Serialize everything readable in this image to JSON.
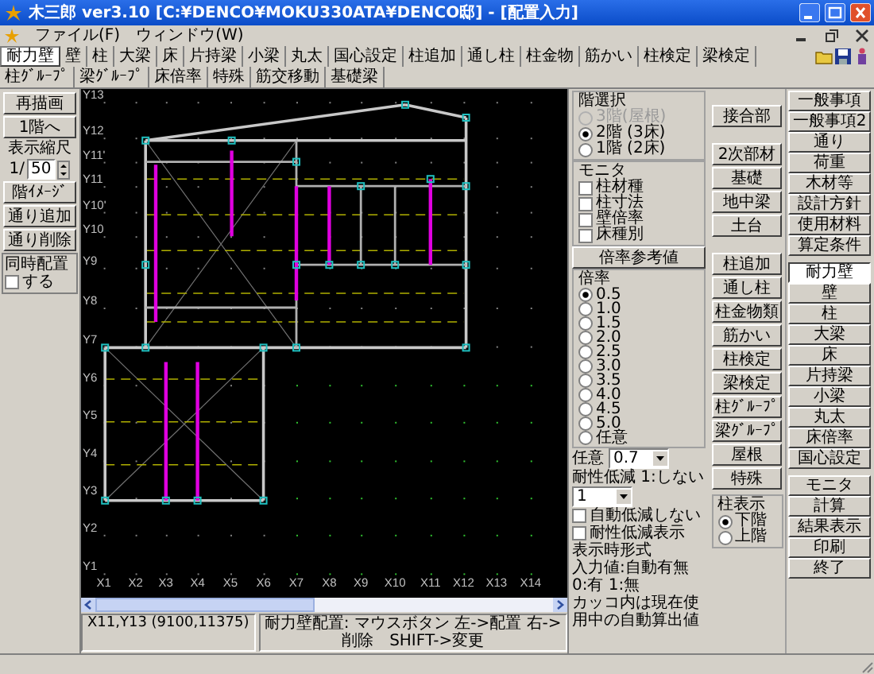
{
  "window": {
    "title": "木三郎 ver3.10 [C:¥DENCO¥MOKU330ATA¥DENCO邸] - [配置入力]"
  },
  "menu": [
    "ファイル(F)",
    "ウィンドウ(W)"
  ],
  "tabs": [
    {
      "label": "耐力壁",
      "selected": true
    },
    {
      "label": "壁",
      "selected": false
    },
    {
      "label": "柱",
      "selected": false
    },
    {
      "label": "大梁",
      "selected": false
    },
    {
      "label": "床",
      "selected": false
    },
    {
      "label": "片持梁",
      "selected": false
    },
    {
      "label": "小梁",
      "selected": false
    },
    {
      "label": "丸太",
      "selected": false
    },
    {
      "label": "国心設定",
      "selected": false
    },
    {
      "label": "柱追加",
      "selected": false
    },
    {
      "label": "通し柱",
      "selected": false
    },
    {
      "label": "柱金物",
      "selected": false
    },
    {
      "label": "筋かい",
      "selected": false
    },
    {
      "label": "柱検定",
      "selected": false
    },
    {
      "label": "梁検定",
      "selected": false
    },
    {
      "label": "柱ｸﾞﾙｰﾌﾟ",
      "selected": false
    },
    {
      "label": "梁ｸﾞﾙｰﾌﾟ",
      "selected": false
    },
    {
      "label": "床倍率",
      "selected": false
    },
    {
      "label": "特殊",
      "selected": false
    },
    {
      "label": "筋交移動",
      "selected": false
    },
    {
      "label": "基礎梁",
      "selected": false
    }
  ],
  "left_panel": {
    "top_buttons": [
      "再描画",
      "1階へ"
    ],
    "scale_label": "表示縮尺",
    "scale_prefix": "1/",
    "scale_value": "50",
    "buttons": [
      "階ｲﾒｰｼﾞ",
      "通り追加",
      "通り削除"
    ],
    "simultaneous": {
      "title": "同時配置",
      "label": "する",
      "checked": false
    }
  },
  "canvas": {
    "y_labels": [
      "Y13",
      "Y12",
      "Y11'",
      "Y11",
      "Y10'",
      "Y10",
      "Y9",
      "Y8",
      "Y7",
      "Y6",
      "Y5",
      "Y4",
      "Y3",
      "Y2",
      "Y1"
    ],
    "x_labels": [
      "X1",
      "X2",
      "X3",
      "X4",
      "X5",
      "X6",
      "X7",
      "X8",
      "X9",
      "X10",
      "X11",
      "X12",
      "X13",
      "X14"
    ]
  },
  "coordinates": "X11,Y13 (9100,11375)",
  "hint": "耐力壁配置: マウスボタン 左->配置 右->削除　SHIFT->変更",
  "right_panel": {
    "floor_select": {
      "title": "階選択",
      "options": [
        {
          "label": "3階(屋根)",
          "selected": false,
          "disabled": true
        },
        {
          "label": "2階 (3床)",
          "selected": true,
          "disabled": false
        },
        {
          "label": "1階 (2床)",
          "selected": false,
          "disabled": false
        }
      ]
    },
    "monitor": {
      "title": "モニタ",
      "items": [
        {
          "label": "柱材種",
          "checked": false
        },
        {
          "label": "柱寸法",
          "checked": false
        },
        {
          "label": "壁倍率",
          "checked": false
        },
        {
          "label": "床種別",
          "checked": false
        }
      ]
    },
    "reference_button": "倍率参考値",
    "ratio": {
      "title": "倍率",
      "options": [
        {
          "label": "0.5",
          "selected": true
        },
        {
          "label": "1.0",
          "selected": false
        },
        {
          "label": "1.5",
          "selected": false
        },
        {
          "label": "2.0",
          "selected": false
        },
        {
          "label": "2.5",
          "selected": false
        },
        {
          "label": "3.0",
          "selected": false
        },
        {
          "label": "3.5",
          "selected": false
        },
        {
          "label": "4.0",
          "selected": false
        },
        {
          "label": "4.5",
          "selected": false
        },
        {
          "label": "5.0",
          "selected": false
        },
        {
          "label": "任意",
          "selected": false
        }
      ]
    },
    "arbitrary": {
      "label": "任意",
      "value": "0.7"
    },
    "reduction": {
      "label": "耐性低減 1:しない",
      "value": "1"
    },
    "checks": [
      {
        "label": "自動低減しない",
        "checked": false
      },
      {
        "label": "耐性低減表示",
        "checked": false
      }
    ],
    "notes": [
      "表示時形式",
      "入力値:自動有無",
      "0:有 1:無",
      "カッコ内は現在使用中の自動算出値"
    ],
    "middle_buttons": [
      "接合部",
      "2次部材",
      "基礎",
      "地中梁",
      "土台",
      "柱追加",
      "通し柱",
      "柱金物類",
      "筋かい",
      "柱検定",
      "梁検定",
      "柱ｸﾞﾙｰﾌﾟ",
      "梁ｸﾞﾙｰﾌﾟ",
      "屋根",
      "特殊"
    ],
    "column_display": {
      "title": "柱表示",
      "options": [
        {
          "label": "下階",
          "selected": true
        },
        {
          "label": "上階",
          "selected": false
        }
      ]
    },
    "side_buttons": [
      {
        "label": "一般事項",
        "selected": false
      },
      {
        "label": "一般事項2",
        "selected": false
      },
      {
        "label": "通り",
        "selected": false
      },
      {
        "label": "荷重",
        "selected": false
      },
      {
        "label": "木材等",
        "selected": false
      },
      {
        "label": "設計方針",
        "selected": false
      },
      {
        "label": "使用材料",
        "selected": false
      },
      {
        "label": "算定条件",
        "selected": false
      },
      {
        "label": "耐力壁",
        "selected": true
      },
      {
        "label": "壁",
        "selected": false
      },
      {
        "label": "柱",
        "selected": false
      },
      {
        "label": "大梁",
        "selected": false
      },
      {
        "label": "床",
        "selected": false
      },
      {
        "label": "片持梁",
        "selected": false
      },
      {
        "label": "小梁",
        "selected": false
      },
      {
        "label": "丸太",
        "selected": false
      },
      {
        "label": "床倍率",
        "selected": false
      },
      {
        "label": "国心設定",
        "selected": false
      },
      {
        "label": "モニタ",
        "selected": false
      },
      {
        "label": "計算",
        "selected": false
      },
      {
        "label": "結果表示",
        "selected": false
      },
      {
        "label": "印刷",
        "selected": false
      },
      {
        "label": "終了",
        "selected": false
      }
    ]
  }
}
